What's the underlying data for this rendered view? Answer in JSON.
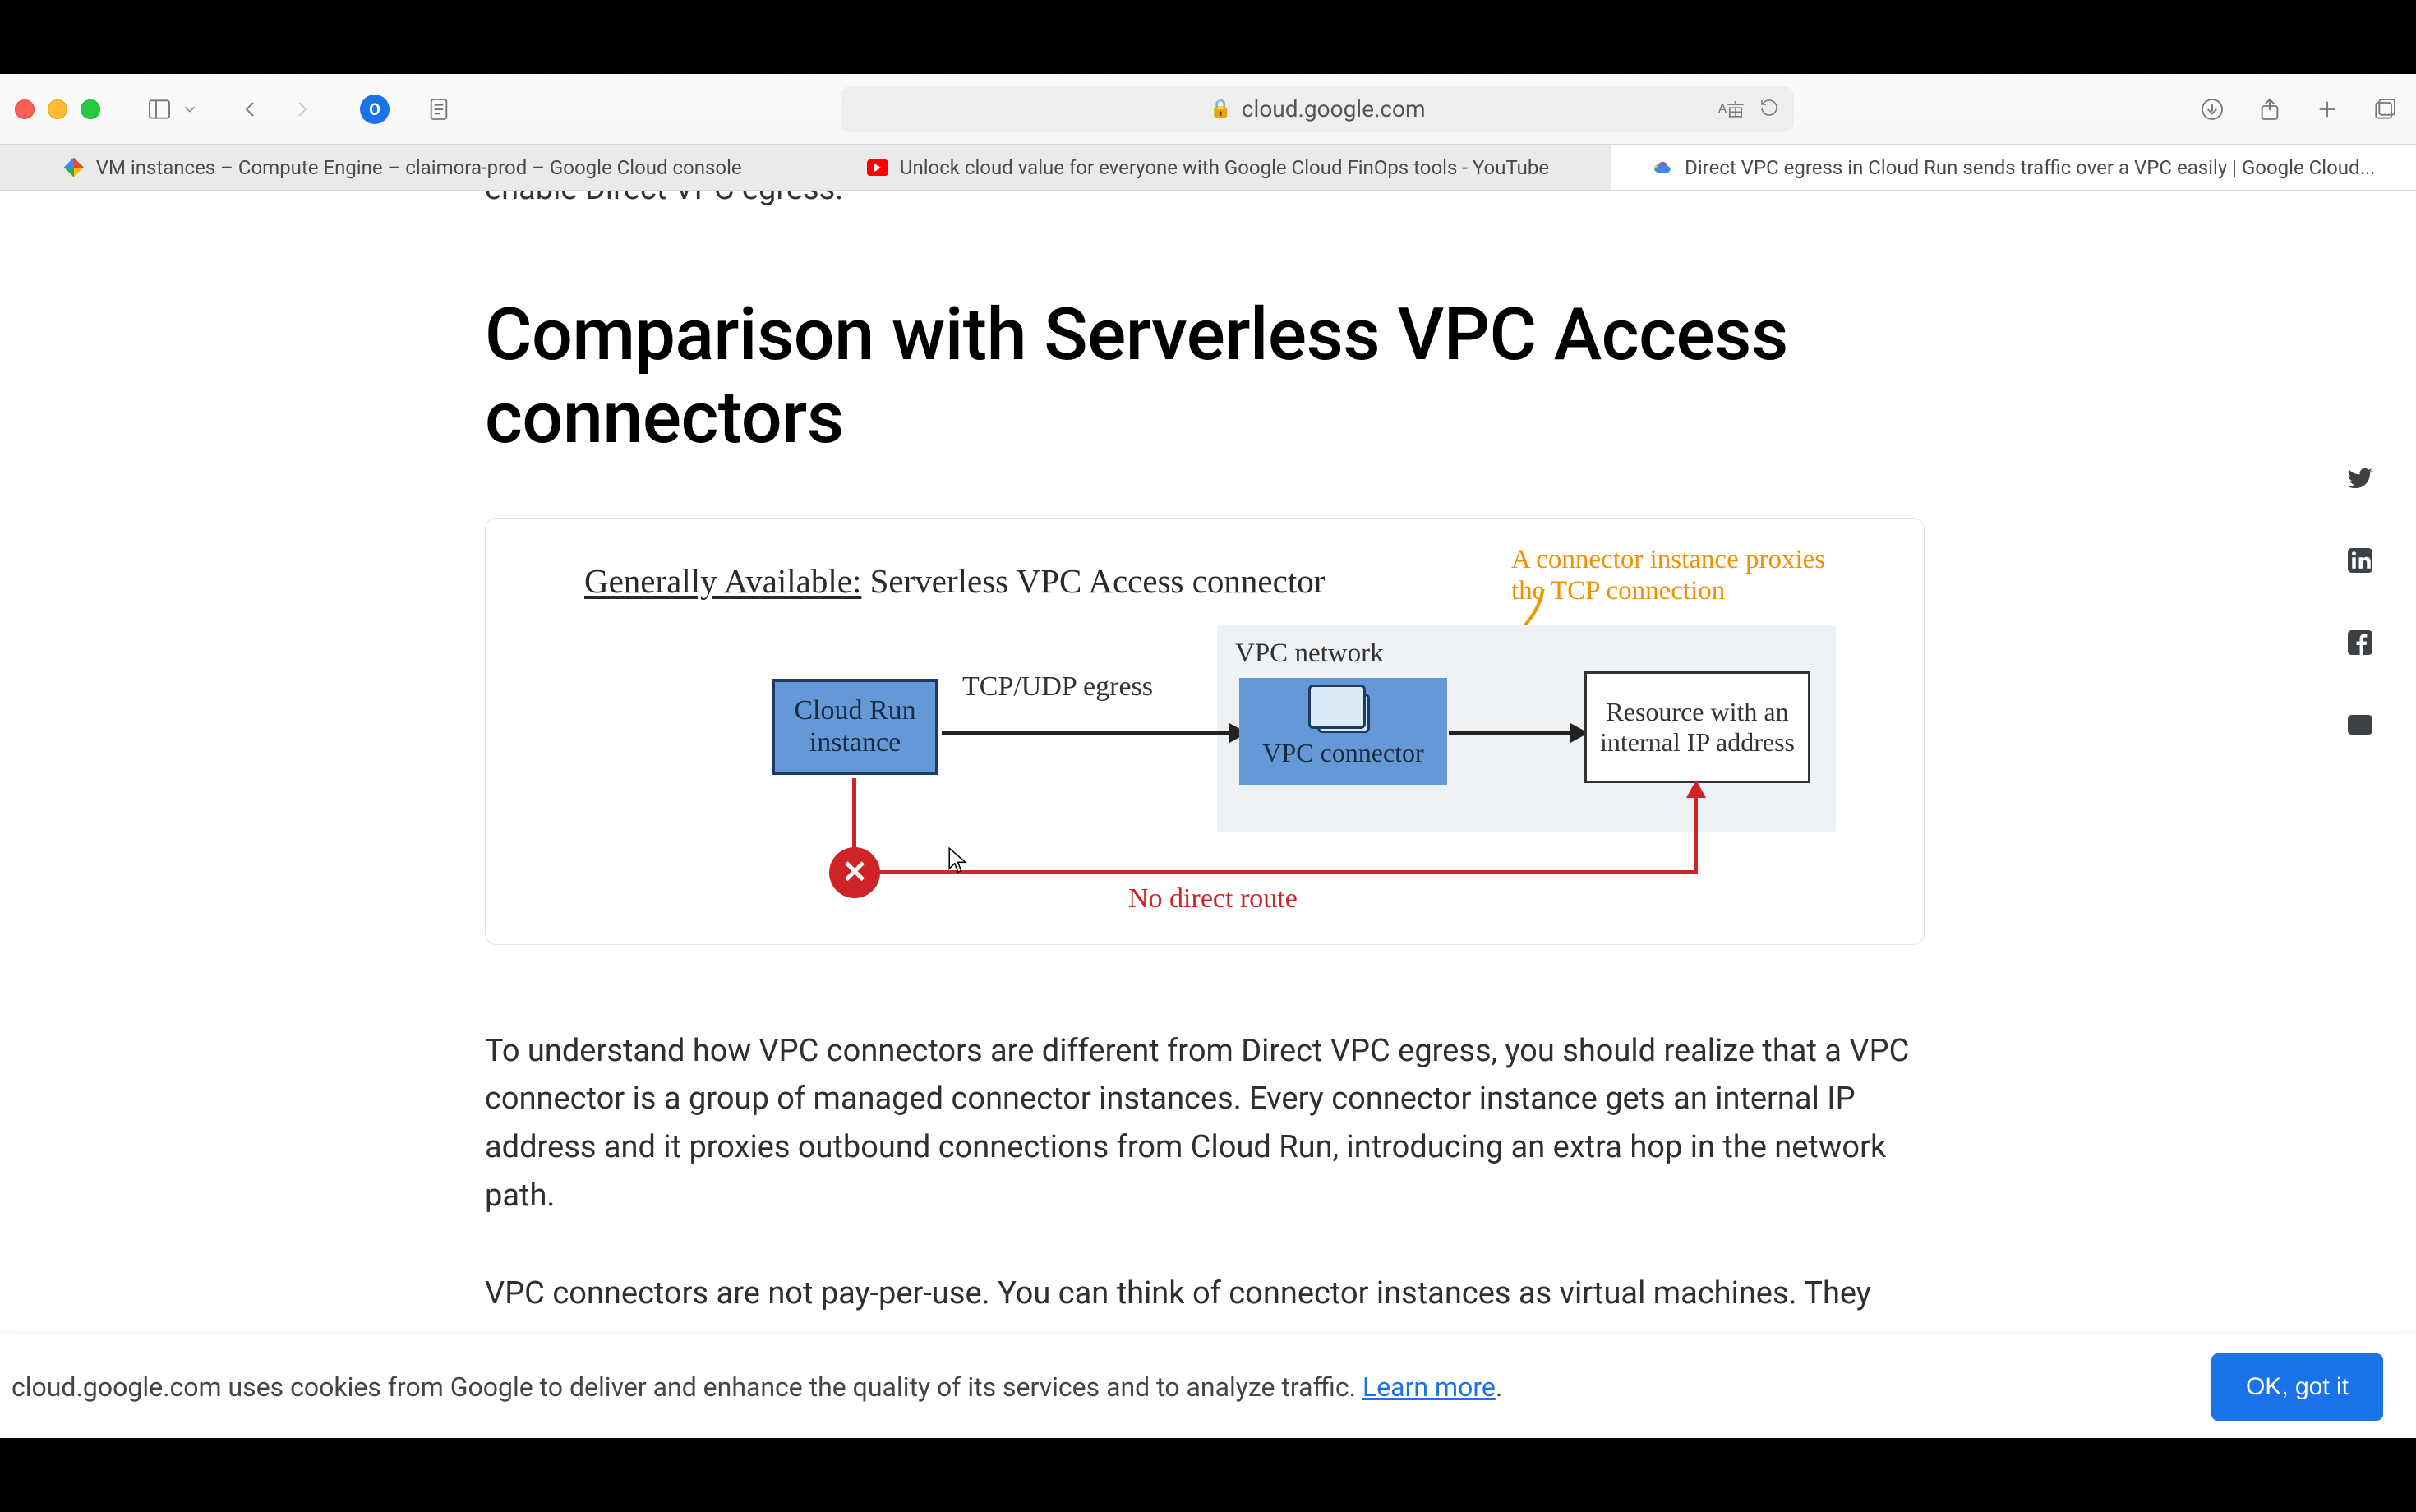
{
  "browser": {
    "url_host": "cloud.google.com",
    "tabs": [
      {
        "label": "VM instances – Compute Engine – claimora-prod – Google Cloud console"
      },
      {
        "label": "Unlock cloud value for everyone with Google Cloud FinOps tools - YouTube"
      },
      {
        "label": "Direct VPC egress in Cloud Run sends traffic over a VPC easily | Google Cloud..."
      }
    ]
  },
  "page": {
    "truncated_prev_line": "enable Direct VPC egress.",
    "heading": "Comparison with Serverless VPC Access connectors",
    "paragraph1": "To understand how VPC connectors are different from Direct VPC egress, you should realize that a VPC connector is a group of managed connector instances. Every connector instance gets an internal IP address and it proxies outbound connections from Cloud Run, introducing an extra hop in the network path.",
    "paragraph2_visible": "VPC connectors are not pay-per-use. You can think of connector instances as virtual machines. They"
  },
  "diagram": {
    "title_underlined": "Generally Available:",
    "title_rest": " Serverless VPC Access connector",
    "annotation": "A connector instance proxies the TCP connection",
    "vpc_label": "VPC network",
    "cloud_run_box": "Cloud Run\ninstance",
    "tcp_label": "TCP/UDP egress",
    "connector_label": "VPC connector",
    "resource_label": "Resource with an internal IP address",
    "no_direct_route": "No direct route",
    "x_mark": "✕"
  },
  "share": {
    "twitter": "twitter-icon",
    "linkedin": "linkedin-icon",
    "facebook": "facebook-icon",
    "email": "email-icon"
  },
  "cookie": {
    "text_prefix": "cloud.google.com uses cookies from Google to deliver and enhance the quality of its services and to analyze traffic. ",
    "learn_more": "Learn more",
    "period": ".",
    "button": "OK, got it"
  }
}
